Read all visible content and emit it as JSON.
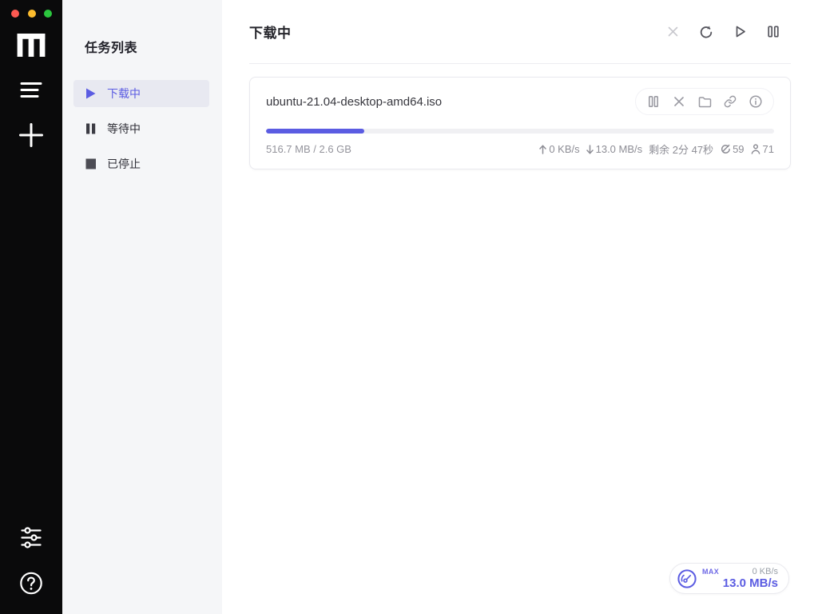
{
  "colors": {
    "accent": "#5b5ce2",
    "rail_bg": "#0a0a0b",
    "sidebar_bg": "#f5f6f8",
    "active_item_bg": "#e8e9f1",
    "progress_track": "#f0f0f3",
    "traffic_red": "#fd5a52",
    "traffic_yellow": "#fdbc2e",
    "traffic_green": "#2bc63e"
  },
  "rail": {
    "icons": [
      "motrix-logo",
      "task-list",
      "add-task",
      "preferences",
      "help"
    ]
  },
  "sidebar": {
    "title": "任务列表",
    "items": [
      {
        "label": "下载中",
        "icon": "play",
        "active": true
      },
      {
        "label": "等待中",
        "icon": "pause",
        "active": false
      },
      {
        "label": "已停止",
        "icon": "stop",
        "active": false
      }
    ]
  },
  "main": {
    "header": {
      "title": "下载中",
      "toolbar": [
        "delete",
        "refresh",
        "resume-all",
        "pause-all"
      ]
    },
    "task": {
      "name": "ubuntu-21.04-desktop-amd64.iso",
      "progress_percent": 19.4,
      "size_text": "516.7 MB / 2.6 GB",
      "upload_speed": "0 KB/s",
      "download_speed": "13.0 MB/s",
      "remaining": "剩余 2分 47秒",
      "seeders": "59",
      "connections": "71",
      "actions": [
        "pause",
        "delete",
        "open-folder",
        "copy-link",
        "info"
      ]
    }
  },
  "speed_widget": {
    "max_label": "MAX",
    "upload_speed": "0 KB/s",
    "download_speed": "13.0 MB/s"
  }
}
